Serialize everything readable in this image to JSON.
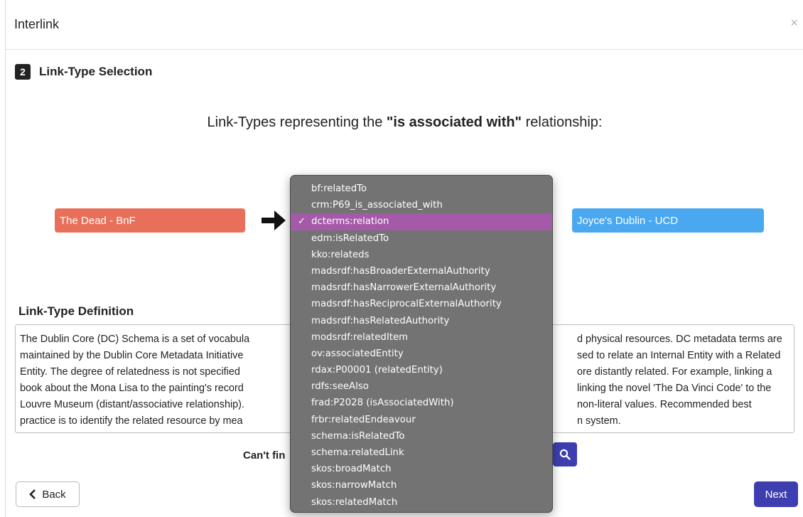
{
  "modal": {
    "title": "Interlink",
    "close": "×"
  },
  "step": {
    "number": "2",
    "title": "Link-Type Selection"
  },
  "heading": {
    "prefix": "Link-Types representing the ",
    "relation": "\"is associated with\"",
    "suffix": " relationship:"
  },
  "entities": {
    "source": "The Dead - BnF",
    "target": "Joyce's Dublin - UCD"
  },
  "definition": {
    "label": "Link-Type Definition",
    "text": "The Dublin Core (DC) Schema is a set of vocabula                                                                    d physical resources. DC metadata terms are maintained by the Dublin Core Metadata Initiative                                                                  sed to relate an Internal Entity with a Related Entity. The degree of relatedness is not specified                                                                 ore distantly related. For example, linking a book about the Mona Lisa to the painting's record                                                                  linking the novel 'The Da Vinci Code' to the Louvre Museum (distant/associative relationship).                                                                  non-literal values. Recommended best practice is to identify the related resource by mea                                                                   n system."
  },
  "definition_lines": [
    {
      "left": "The Dublin Core (DC) Schema is a set of vocabula",
      "right": "d physical resources. DC metadata terms are"
    },
    {
      "left": "maintained by the Dublin Core Metadata Initiative",
      "right": "sed to relate an Internal Entity with a Related"
    },
    {
      "left": "Entity. The degree of relatedness is not specified",
      "right": "ore distantly related. For example, linking a"
    },
    {
      "left": "book about the Mona Lisa to the painting's record",
      "right": "linking the novel 'The Da Vinci Code' to the"
    },
    {
      "left": "Louvre Museum (distant/associative relationship).",
      "right": "non-literal values. Recommended best"
    },
    {
      "left": "practice is to identify the related resource by mea",
      "right": "n system."
    }
  ],
  "search": {
    "prompt": "Can't fin",
    "button_icon": "search-icon"
  },
  "buttons": {
    "back": "Back",
    "next": "Next"
  },
  "dropdown": {
    "selected": "dcterms:relation",
    "options": [
      "bf:relatedTo",
      "crm:P69_is_associated_with",
      "dcterms:relation",
      "edm:isRelatedTo",
      "kko:relateds",
      "madsrdf:hasBroaderExternalAuthority",
      "madsrdf:hasNarrowerExternalAuthority",
      "madsrdf:hasReciprocalExternalAuthority",
      "madsrdf:hasRelatedAuthority",
      "modsrdf:relatedItem",
      "ov:associatedEntity",
      "rdax:P00001 (relatedEntity)",
      "rdfs:seeAlso",
      "frad:P2028 (isAssociatedWith)",
      "frbr:relatedEndeavour",
      "schema:isRelatedTo",
      "schema:relatedLink",
      "skos:broadMatch",
      "skos:narrowMatch",
      "skos:relatedMatch"
    ]
  },
  "colors": {
    "source_entity": "#e8705a",
    "target_entity": "#4aa8f0",
    "primary_button": "#3d3fb0",
    "selected_option": "#a45aa8"
  }
}
